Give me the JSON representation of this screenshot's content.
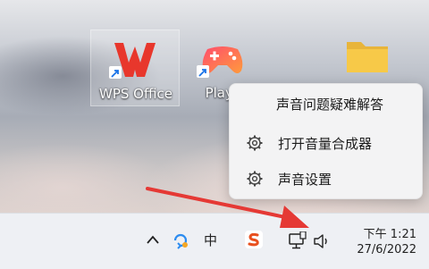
{
  "desktop": {
    "icons": [
      {
        "label": "WPS Office"
      },
      {
        "label": "Playn"
      }
    ]
  },
  "flyout": {
    "items": [
      {
        "label": "声音问题疑难解答"
      },
      {
        "label": "打开音量合成器"
      },
      {
        "label": "声音设置"
      }
    ]
  },
  "taskbar": {
    "ime_label": "中",
    "clock_time": "下午 1:21",
    "clock_date": "27/6/2022"
  },
  "colors": {
    "wps_red": "#e8372c",
    "annotation_arrow": "#e53935",
    "folder_yellow": "#f7c948"
  }
}
